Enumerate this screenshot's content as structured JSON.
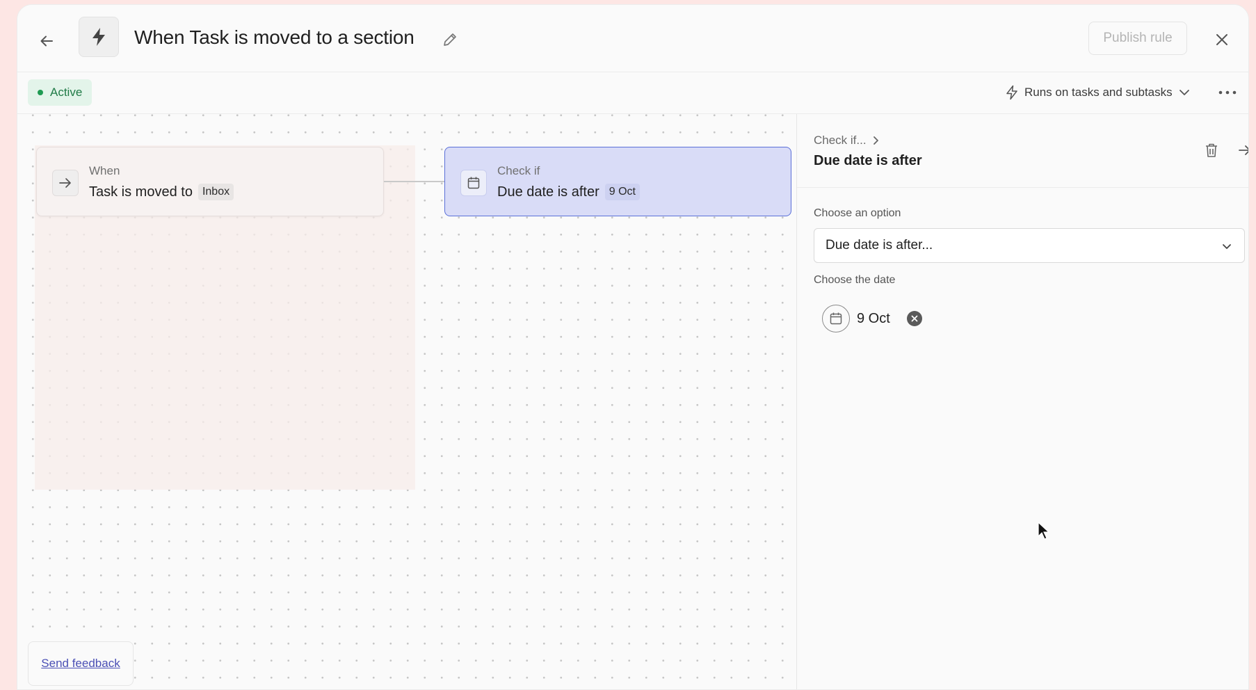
{
  "header": {
    "title": "When Task is moved to a section",
    "publish_label": "Publish rule",
    "icons": {
      "back": "arrow-left-icon",
      "rule": "lightning-bolt-icon",
      "edit": "pencil-icon",
      "close": "close-icon"
    }
  },
  "subheader": {
    "status": "Active",
    "status_color": "#1f9a52",
    "runs_on_label": "Runs on tasks and subtasks",
    "icons": {
      "runs_on": "lightning-outline-icon",
      "dropdown": "chevron-down-icon",
      "more": "more-horizontal-icon"
    }
  },
  "canvas": {
    "when_node": {
      "kicker": "When",
      "text": "Task is moved to",
      "chip": "Inbox",
      "icon": "arrow-right-icon"
    },
    "check_node": {
      "kicker": "Check if",
      "text": "Due date is after",
      "chip": "9 Oct",
      "icon": "calendar-icon",
      "accent": "#5a6fd8"
    },
    "feedback_label": "Send feedback"
  },
  "panel": {
    "breadcrumb": "Check if...",
    "title": "Due date is after",
    "option_label": "Choose an option",
    "option_value": "Due date is after...",
    "date_label": "Choose the date",
    "date_value": "9 Oct",
    "icons": {
      "delete": "trash-icon",
      "collapse": "collapse-panel-icon",
      "calendar": "calendar-icon",
      "clear": "clear-circle-icon"
    }
  }
}
